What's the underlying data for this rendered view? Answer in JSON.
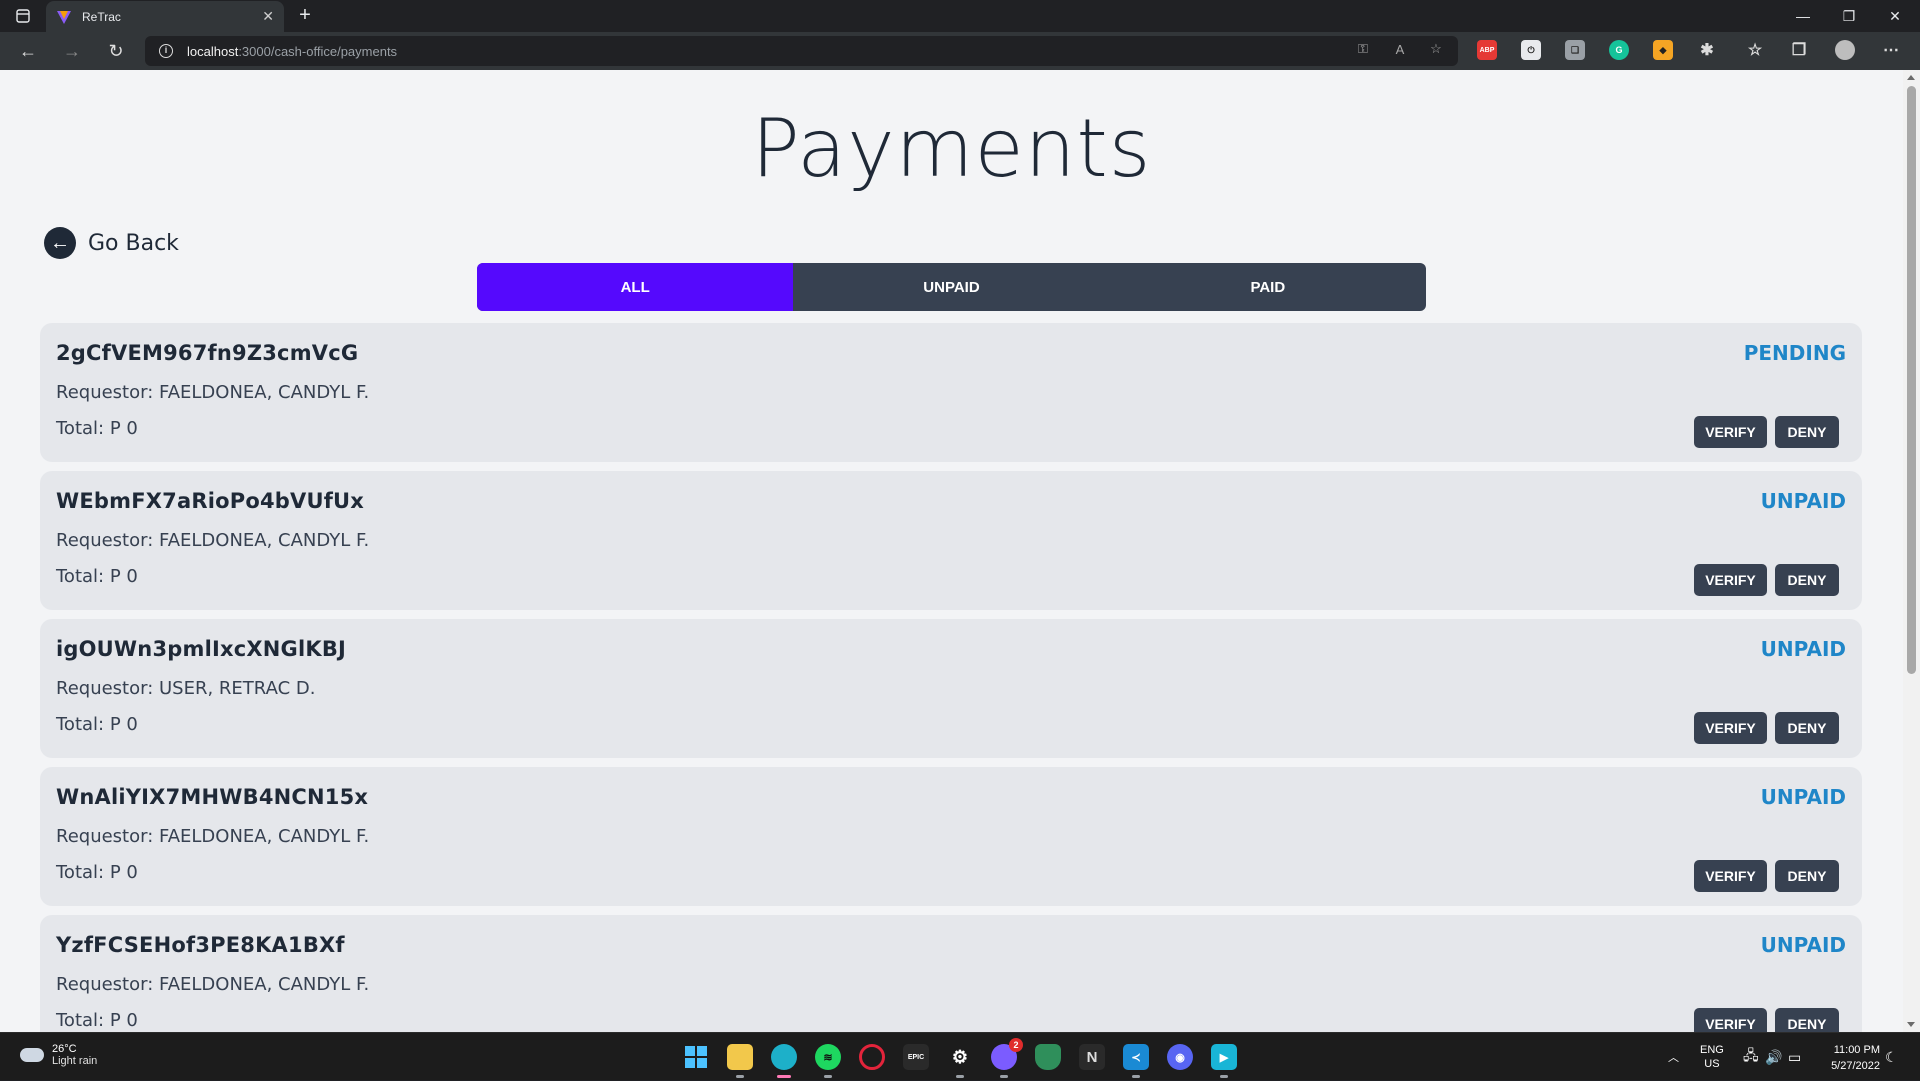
{
  "browser": {
    "tab_title": "ReTrac",
    "url_host": "localhost",
    "url_path": ":3000/cash-office/payments"
  },
  "page": {
    "title": "Payments",
    "go_back": "Go Back",
    "filters": [
      {
        "label": "ALL",
        "active": true
      },
      {
        "label": "UNPAID",
        "active": false
      },
      {
        "label": "PAID",
        "active": false
      }
    ],
    "payments": [
      {
        "id": "2gCfVEM967fn9Z3cmVcG",
        "requestor": "Requestor: FAELDONEA, CANDYL F.",
        "total": "Total: P 0",
        "status": "PENDING",
        "verify": "VERIFY",
        "deny": "DENY"
      },
      {
        "id": "WEbmFX7aRioPo4bVUfUx",
        "requestor": "Requestor: FAELDONEA, CANDYL F.",
        "total": "Total: P 0",
        "status": "UNPAID",
        "verify": "VERIFY",
        "deny": "DENY"
      },
      {
        "id": "igOUWn3pmlIxcXNGlKBJ",
        "requestor": "Requestor: USER, RETRAC D.",
        "total": "Total: P 0",
        "status": "UNPAID",
        "verify": "VERIFY",
        "deny": "DENY"
      },
      {
        "id": "WnAliYIX7MHWB4NCN15x",
        "requestor": "Requestor: FAELDONEA, CANDYL F.",
        "total": "Total: P 0",
        "status": "UNPAID",
        "verify": "VERIFY",
        "deny": "DENY"
      },
      {
        "id": "YzfFCSEHof3PE8KA1BXf",
        "requestor": "Requestor: FAELDONEA, CANDYL F.",
        "total": "Total: P 0",
        "status": "UNPAID",
        "verify": "VERIFY",
        "deny": "DENY"
      }
    ],
    "colors": {
      "accent": "#5509fd",
      "status": "#1f86c8",
      "button": "#374151"
    }
  },
  "taskbar": {
    "weather_temp": "26°C",
    "weather_desc": "Light rain",
    "lang": "ENG",
    "region": "US",
    "time": "11:00 PM",
    "date": "5/27/2022",
    "messenger_badge": "2"
  }
}
